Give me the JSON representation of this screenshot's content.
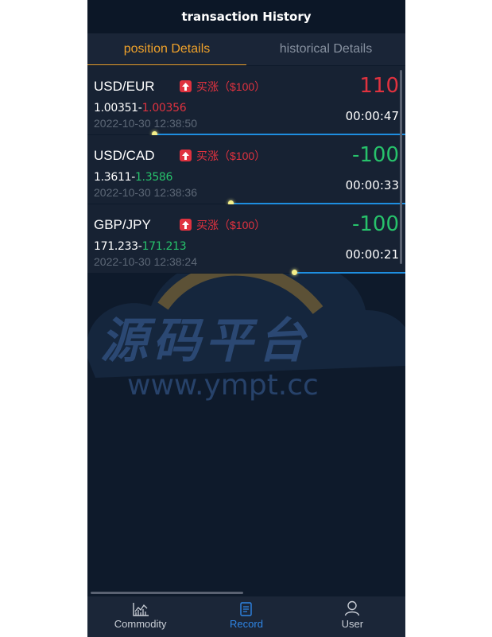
{
  "header": {
    "title": "transaction History"
  },
  "tabs": [
    {
      "label": "position Details",
      "active": true
    },
    {
      "label": "historical Details",
      "active": false
    }
  ],
  "positions": [
    {
      "symbol": "USD/EUR",
      "direction_icon": "arrow-up-icon",
      "direction": "买涨（$100）",
      "open_price": "1.00351",
      "separator": "-",
      "current_price": "1.00356",
      "current_color": "#e0323f",
      "time": "2022-10-30 12:38:50",
      "pl": "110",
      "pl_color": "#e0323f",
      "countdown": "00:00:47",
      "progress": 0.79
    },
    {
      "symbol": "USD/CAD",
      "direction_icon": "arrow-up-icon",
      "direction": "买涨（$100）",
      "open_price": "1.3611",
      "separator": "-",
      "current_price": "1.3586",
      "current_color": "#27c26b",
      "time": "2022-10-30 12:38:36",
      "pl": "-100",
      "pl_color": "#27c26b",
      "countdown": "00:00:33",
      "progress": 0.55
    },
    {
      "symbol": "GBP/JPY",
      "direction_icon": "arrow-up-icon",
      "direction": "买涨（$100）",
      "open_price": "171.233",
      "separator": "-",
      "current_price": "171.213",
      "current_color": "#27c26b",
      "time": "2022-10-30 12:38:24",
      "pl": "-100",
      "pl_color": "#27c26b",
      "countdown": "00:00:21",
      "progress": 0.35
    }
  ],
  "watermark": {
    "text": "源码平台",
    "url": "www.ympt.cc"
  },
  "tabbar": [
    {
      "label": "Commodity",
      "icon": "chart-icon",
      "active": false
    },
    {
      "label": "Record",
      "icon": "document-icon",
      "active": true
    },
    {
      "label": "User",
      "icon": "user-icon",
      "active": false
    }
  ],
  "colors": {
    "accent": "#f0a22a",
    "up": "#e0323f",
    "down": "#27c26b",
    "active_tab": "#2f86e6",
    "progress": "#1e8ee0"
  }
}
